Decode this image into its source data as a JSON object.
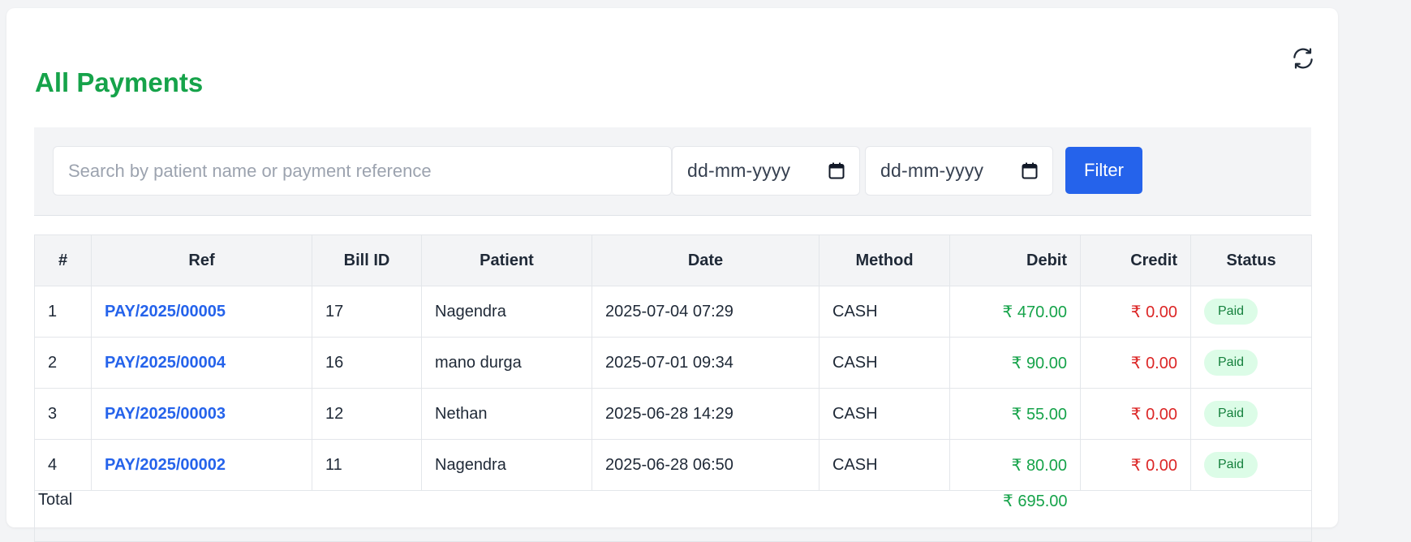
{
  "header": {
    "title": "All Payments",
    "refresh_icon": "refresh-icon"
  },
  "filters": {
    "search_placeholder": "Search by patient name or payment reference",
    "search_value": "",
    "from_date": "dd-mm-yyyy",
    "to_date": "dd-mm-yyyy",
    "calendar_icon": "calendar-icon",
    "filter_label": "Filter"
  },
  "table": {
    "columns": [
      "#",
      "Ref",
      "Bill ID",
      "Patient",
      "Date",
      "Method",
      "Debit",
      "Credit",
      "Status"
    ],
    "rows": [
      {
        "num": "1",
        "ref": "PAY/2025/00005",
        "bill_id": "17",
        "patient": "Nagendra",
        "date": "2025-07-04 07:29",
        "method": "CASH",
        "debit": "₹ 470.00",
        "credit": "₹ 0.00",
        "status": "Paid"
      },
      {
        "num": "2",
        "ref": "PAY/2025/00004",
        "bill_id": "16",
        "patient": "mano durga",
        "date": "2025-07-01 09:34",
        "method": "CASH",
        "debit": "₹ 90.00",
        "credit": "₹ 0.00",
        "status": "Paid"
      },
      {
        "num": "3",
        "ref": "PAY/2025/00003",
        "bill_id": "12",
        "patient": "Nethan",
        "date": "2025-06-28 14:29",
        "method": "CASH",
        "debit": "₹ 55.00",
        "credit": "₹ 0.00",
        "status": "Paid"
      },
      {
        "num": "4",
        "ref": "PAY/2025/00002",
        "bill_id": "11",
        "patient": "Nagendra",
        "date": "2025-06-28 06:50",
        "method": "CASH",
        "debit": "₹ 80.00",
        "credit": "₹ 0.00",
        "status": "Paid"
      }
    ],
    "total": {
      "label": "Total",
      "debit": "₹ 695.00"
    }
  },
  "colors": {
    "title": "#16a34a",
    "link": "#2563eb",
    "button_bg": "#2563eb",
    "button_text": "#ffffff",
    "debit": "#16a34a",
    "credit": "#dc2626",
    "badge_bg": "#dcfce7",
    "badge_text": "#15803d",
    "header_bg": "#f3f4f6",
    "icon": "#1f2937"
  }
}
